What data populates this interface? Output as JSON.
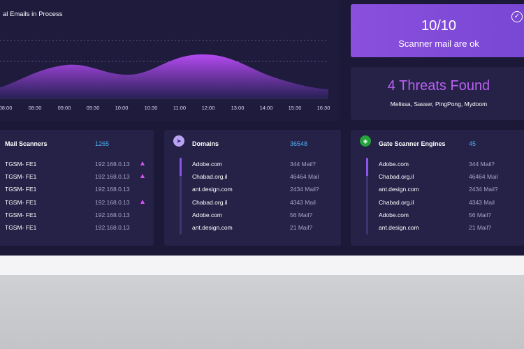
{
  "chart": {
    "title": "al Emails in Process",
    "ticks": [
      "08:00",
      "08:30",
      "09:00",
      "09:30",
      "10:00",
      "10:30",
      "11:00",
      "12:00",
      "13:00",
      "14:00",
      "15:30",
      "16:30"
    ],
    "colors": {
      "fill_top": "#b44af0",
      "fill_bottom": "#2a2158",
      "grid": "#6e6a94"
    }
  },
  "score": {
    "value": "10/10",
    "caption": "Scanner mail are ok"
  },
  "threats": {
    "title": "4 Threats Found",
    "names": "Melissa, Sasser, PingPong, Mydoom"
  },
  "mail_scanners": {
    "title": "Mail Scanners",
    "count": "1265",
    "rows": [
      {
        "name": "TGSM- FE1",
        "ip": "192.168.0.13",
        "warning": true
      },
      {
        "name": "TGSM- FE1",
        "ip": "192.168.0.13",
        "warning": true
      },
      {
        "name": "TGSM- FE1",
        "ip": "192.168.0.13",
        "warning": false
      },
      {
        "name": "TGSM- FE1",
        "ip": "192.168.0.13",
        "warning": true
      },
      {
        "name": "TGSM- FE1",
        "ip": "192.168.0.13",
        "warning": false
      },
      {
        "name": "TGSM- FE1",
        "ip": "192.168.0.13",
        "warning": false
      }
    ]
  },
  "domains": {
    "title": "Domains",
    "count": "36548",
    "icon": "send-icon",
    "rows": [
      {
        "domain": "Adobe.com",
        "mail": "344 Mail?"
      },
      {
        "domain": "Chabad.org.il",
        "mail": "46464 Mail"
      },
      {
        "domain": "ant.design.com",
        "mail": "2434 Mail?"
      },
      {
        "domain": "Chabad.org.il",
        "mail": "4343 Mail"
      },
      {
        "domain": "Adobe.com",
        "mail": "56 Mail?"
      },
      {
        "domain": "ant.design.com",
        "mail": "21 Mail?"
      }
    ]
  },
  "gate": {
    "title": "Gate Scanner Engines",
    "count": "45",
    "icon": "shield-icon",
    "rows": [
      {
        "domain": "Adobe.com",
        "mail": "344 Mail?"
      },
      {
        "domain": "Chabad.org.il",
        "mail": "46464 Mail"
      },
      {
        "domain": "ant.design.com",
        "mail": "2434 Mail?"
      },
      {
        "domain": "Chabad.org.il",
        "mail": "4343 Mail"
      },
      {
        "domain": "Adobe.com",
        "mail": "56 Mail?"
      },
      {
        "domain": "ant.design.com",
        "mail": "21 Mail?"
      }
    ]
  }
}
